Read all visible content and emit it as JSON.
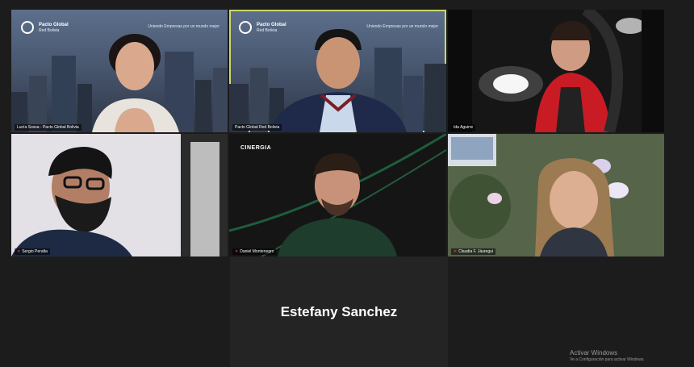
{
  "branding": {
    "org_line1": "Pacto Global",
    "org_line2": "Red Bolivia",
    "slogan": "Uniendo Empresas por un mundo mejor"
  },
  "participants": [
    {
      "id": "p1",
      "name": "Lucía Sossa - Pacto Global Bolivia",
      "muted": false
    },
    {
      "id": "p2",
      "name": "Pacto Global Red Bolivia",
      "muted": false,
      "active_speaker": true
    },
    {
      "id": "p3",
      "name": "Ida Aguirre",
      "muted": false
    },
    {
      "id": "p4",
      "name": "Sergio Peralta",
      "muted": true
    },
    {
      "id": "p5",
      "name": "Daniel Montenegro",
      "muted": true
    },
    {
      "id": "p6",
      "name": "Claudia F. Jáuregui",
      "muted": true
    }
  ],
  "p5_background_brand": "CINERGIA",
  "camera_off_participant": "Estefany Sanchez",
  "system_overlay": {
    "title": "Activar Windows",
    "subtitle": "Ve a Configuración para activar Windows."
  },
  "colors": {
    "active_speaker_border": "#c8d96a",
    "muted_icon": "#ff4b4b",
    "background": "#1c1c1c"
  }
}
